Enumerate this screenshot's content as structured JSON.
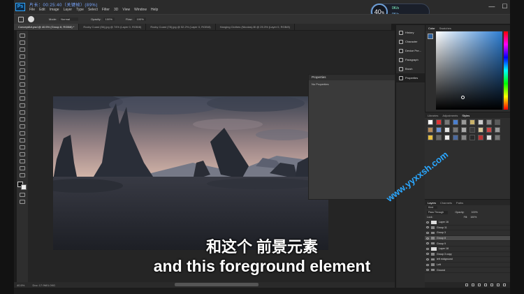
{
  "window": {
    "overlay_text": "片长：00:25:40（关键帧）(89%)",
    "menu": [
      "File",
      "Edit",
      "Image",
      "Layer",
      "Type",
      "Select",
      "Filter",
      "3D",
      "View",
      "Window",
      "Help"
    ],
    "controls": [
      "—",
      "☐",
      "✕"
    ]
  },
  "options_bar": {
    "mode_label": "Mode:",
    "mode_value": "Normal",
    "opacity_label": "Opacity:",
    "opacity_value": "100%",
    "flow_label": "Flow:",
    "flow_value": "100%"
  },
  "tabs": [
    {
      "label": "ConceptArt.psd @ 40.5% (Group 8, RGB/8) *",
      "active": true
    },
    {
      "label": "Rocky Coast (56).jpg @ 74% (Layer 0, RGB/8)",
      "active": false
    },
    {
      "label": "Rocky Coast (78).jpg @ 52.2% (Layer 0, RGB/8)",
      "active": false
    },
    {
      "label": "Hanging Clothes (Nicolas)-Bl @ 25.3% (Layer 0, RGB/8)",
      "active": false
    }
  ],
  "properties": {
    "title": "Properties",
    "body": "No Properties"
  },
  "status": {
    "zoom": "40.5%",
    "doc": "Doc: 17.9M/1.09G"
  },
  "icon_strip": [
    {
      "label": "History",
      "icon": "history-icon"
    },
    {
      "label": "Character",
      "icon": "character-icon"
    },
    {
      "label": "Device Pre...",
      "icon": "device-preview-icon"
    },
    {
      "label": "Paragraph",
      "icon": "paragraph-icon"
    },
    {
      "label": "Brush",
      "icon": "brush-icon"
    },
    {
      "label": "Properties",
      "icon": "properties-icon"
    }
  ],
  "color_panel": {
    "tabs": [
      "Color",
      "Swatches"
    ],
    "active": "Color",
    "fg": "#2d5f9a"
  },
  "swatches_panel": {
    "tabs": [
      "Libraries",
      "Adjustments",
      "Styles"
    ],
    "active": "Styles"
  },
  "layers_panel": {
    "tabs": [
      "Layers",
      "Channels",
      "Paths"
    ],
    "active": "Layers",
    "kind_label": "Kind",
    "blend": "Pass Through",
    "opacity_label": "Opacity:",
    "opacity_value": "100%",
    "lock_label": "Lock:",
    "fill_label": "Fill:",
    "fill_value": "100%",
    "rows": [
      {
        "name": "Layer 16",
        "type": "layer",
        "selected": false
      },
      {
        "name": "Group 11",
        "type": "group",
        "selected": false
      },
      {
        "name": "Group 3",
        "type": "group",
        "selected": false
      },
      {
        "name": "Group 8",
        "type": "group",
        "selected": true
      },
      {
        "name": "Group 9",
        "type": "group",
        "selected": false
      },
      {
        "name": "Layer 18",
        "type": "layer",
        "selected": false
      },
      {
        "name": "Group 3 copy",
        "type": "group",
        "selected": false
      },
      {
        "name": "left midground",
        "type": "group",
        "selected": false
      },
      {
        "name": "Left",
        "type": "group",
        "selected": false
      },
      {
        "name": "Ground",
        "type": "group",
        "selected": false
      }
    ]
  },
  "clock": {
    "value": "40",
    "unit": "%",
    "stat1": "0K/s",
    "stat2": "0K/s"
  },
  "subtitles": {
    "cn": "和这个 前景元素",
    "en": "and this foreground element"
  },
  "watermark": "www.yyxxsh.com"
}
